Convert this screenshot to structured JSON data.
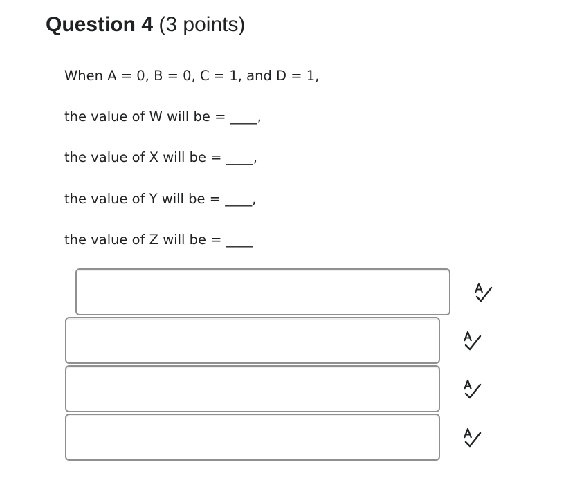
{
  "question": {
    "title": "Question 4",
    "points": "(3 points)"
  },
  "prompt_lines": [
    "When A = 0, B = 0, C = 1, and D = 1,",
    "the value of W will be = ____,",
    "the value of X will be = ____,",
    "the value of Y will be = ____,",
    "the value of Z will be = ____"
  ],
  "answers": [
    {
      "value": "",
      "placeholder": ""
    },
    {
      "value": "",
      "placeholder": ""
    },
    {
      "value": "",
      "placeholder": ""
    },
    {
      "value": "",
      "placeholder": ""
    }
  ],
  "icons": {
    "spell_check": "spell-check-icon"
  },
  "colors": {
    "text": "#202122",
    "input_border": "#909090"
  }
}
